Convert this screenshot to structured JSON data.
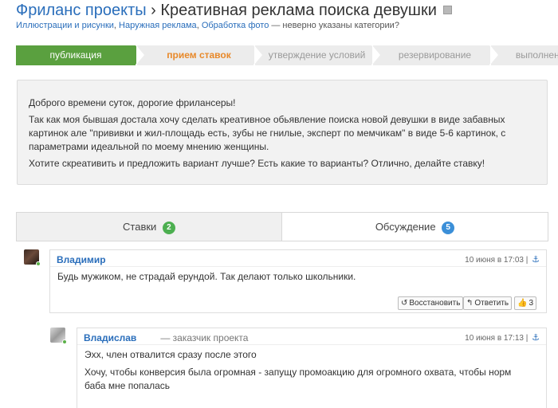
{
  "header": {
    "breadcrumb_link": "Фриланс проекты",
    "separator": "›",
    "title": "Креативная реклама поиска девушки"
  },
  "categories": {
    "items": [
      "Иллюстрации и рисунки",
      "Наружная реклама",
      "Обработка фото"
    ],
    "note": "— неверно указаны категории?"
  },
  "steps": [
    {
      "label": "публикация"
    },
    {
      "label": "прием ставок"
    },
    {
      "label": "утверждение условий"
    },
    {
      "label": "резервирование"
    },
    {
      "label": "выполнение"
    }
  ],
  "description": {
    "p1": "Доброго времени суток, дорогие фрилансеры!",
    "p2": "Так как моя бывшая достала хочу сделать креативное обьявление поиска новой девушки в виде забавных картинок але \"прививки и жил-площадь есть, зубы не гнилые, эксперт по мемчикам\" в виде 5-6 картинок, с параметрами идеальной по моему мнению женщины.",
    "p3": "Хотите скреативить и предложить вариант лучше? Есть какие то варианты? Отлично, делайте ставку!"
  },
  "tabs": {
    "bids_label": "Ставки",
    "bids_count": "2",
    "discussion_label": "Обсуждение",
    "discussion_count": "5"
  },
  "comments": [
    {
      "author": "Владимир",
      "time": "10 июня в 17:03 |",
      "text": "Будь мужиком, не страдай ерундой. Так делают только школьники.",
      "restore_label": "Восстановить",
      "reply_label": "Ответить",
      "likes": "3"
    },
    {
      "author": "Владислав",
      "role": "— заказчик проекта",
      "time": "10 июня в 17:13 |",
      "text1": "Эхх, член отвалится сразу после этого",
      "text2": "Хочу, чтобы конверсия была огромная - запущу промоакцию для огромного охвата, чтобы норм баба мне попалась"
    }
  ],
  "colors": {
    "link": "#2a6ebb",
    "step_active": "#5aa03f",
    "step_current_text": "#e8892a",
    "badge_green": "#4caf50",
    "badge_blue": "#3b8fd8"
  },
  "icons": {
    "lock": "lock-icon",
    "anchor": "anchor-icon",
    "restore": "restore-icon",
    "reply": "reply-icon",
    "like": "thumbs-up-icon"
  }
}
